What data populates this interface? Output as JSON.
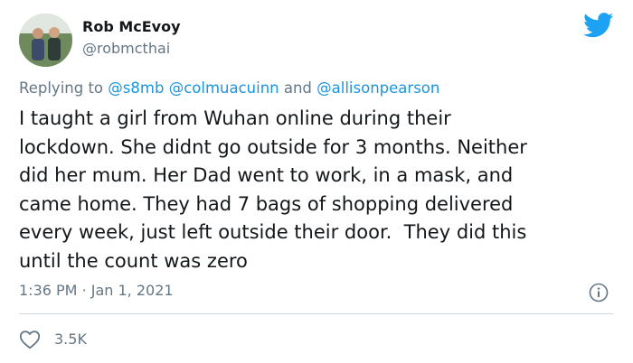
{
  "tweet": {
    "author_name": "Rob McEvoy",
    "author_handle": "@robmcthai",
    "replying_prefix": "Replying to",
    "replying_to": [
      "@s8mb",
      "@colmuacuinn",
      "@allisonpearson"
    ],
    "replying_and": "and",
    "text_lines": [
      "I taught a girl from Wuhan online during their",
      "lockdown. She didnt go outside for 3 months. Neither",
      "did her mum. Her Dad went to work, in a mask, and",
      "came home. They had 7 bags of shopping delivered",
      "every week, just left outside their door.  They did this",
      "until the count was zero"
    ],
    "time": "1:36 PM",
    "separator": "·",
    "date": "Jan 1, 2021",
    "like_count": "3.5K"
  },
  "icons": {
    "brand": "twitter-bird-icon",
    "info": "info-icon",
    "like": "heart-icon"
  },
  "colors": {
    "brand_blue": "#1da1f2",
    "mention_blue": "#1b95e0",
    "text": "#14171a",
    "muted": "#657786",
    "divider": "#cfd9de"
  }
}
